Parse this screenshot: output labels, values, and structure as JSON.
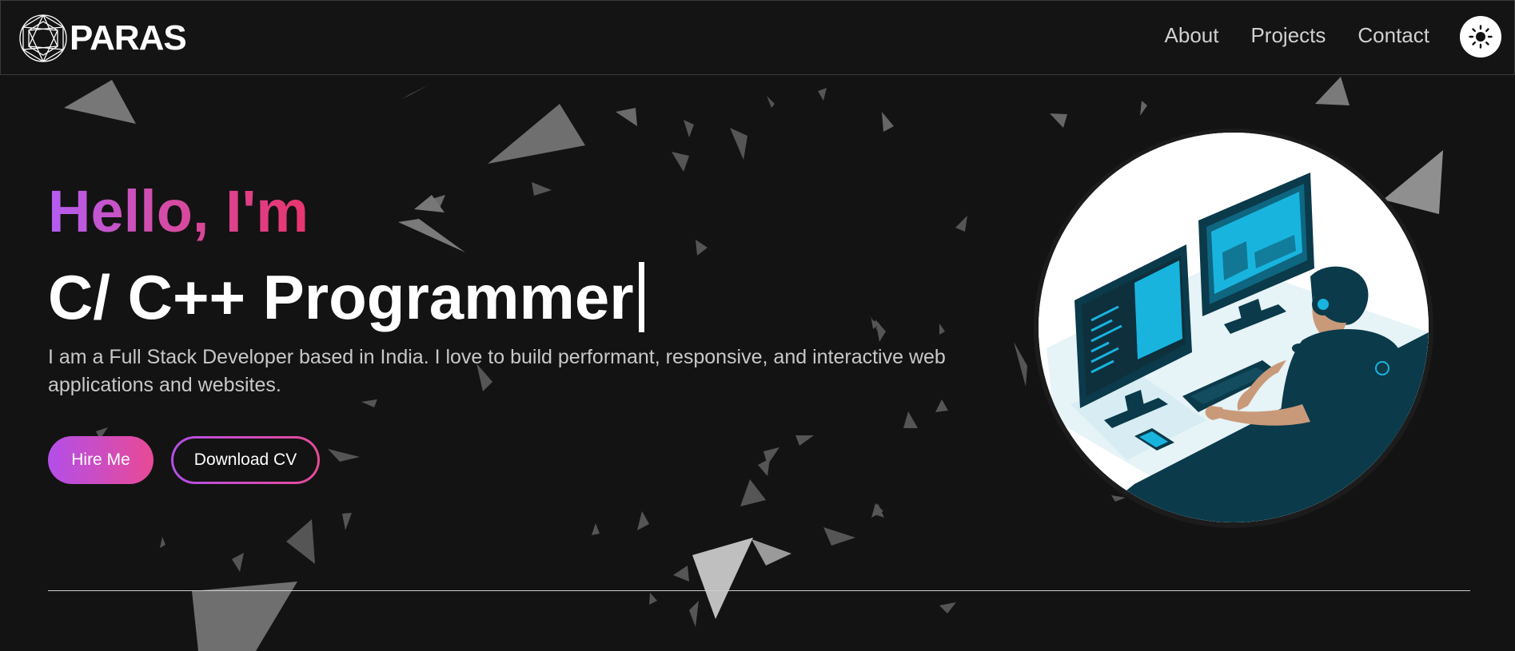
{
  "brand": {
    "name": "PARAS",
    "logo_icon": "geometric-sphere-logo"
  },
  "nav": {
    "links": [
      "About",
      "Projects",
      "Contact"
    ],
    "theme_toggle_icon": "sun-icon"
  },
  "hero": {
    "greeting": "Hello, I'm",
    "role": "C/ C++ Programmer",
    "intro": "I am a Full Stack Developer based in India. I love to build performant, responsive, and interactive web applications and websites.",
    "hire_label": "Hire Me",
    "cv_label": "Download CV"
  },
  "colors": {
    "background": "#131313",
    "gradient_start": "#b35df2",
    "gradient_end": "#e8356d",
    "illustration_primary": "#0b3a4a",
    "illustration_accent": "#18b4de"
  }
}
